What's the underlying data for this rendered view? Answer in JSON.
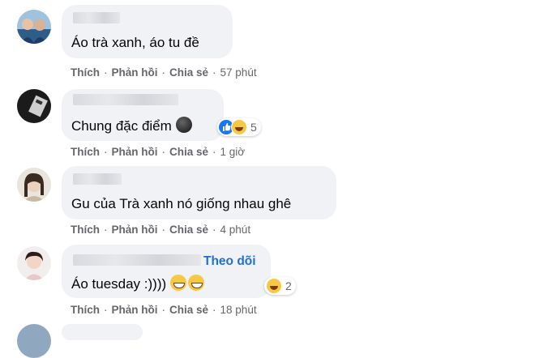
{
  "actions": {
    "like": "Thích",
    "reply": "Phản hồi",
    "share": "Chia sẻ",
    "sep": "·"
  },
  "comments": [
    {
      "text": "Áo trà xanh, áo tu đề",
      "time": "57 phút"
    },
    {
      "text": "Chung đặc điểm",
      "time": "1 giờ",
      "reaction_count": "5",
      "emoji": "dark-circle-emoji"
    },
    {
      "text": "Gu của Trà xanh nó giống nhau ghê",
      "time": "4 phút"
    },
    {
      "text": "Áo tuesday :))))",
      "time": "18 phút",
      "follow": "Theo dõi",
      "reaction_count": "2",
      "emoji": "grinning-emoji"
    }
  ]
}
